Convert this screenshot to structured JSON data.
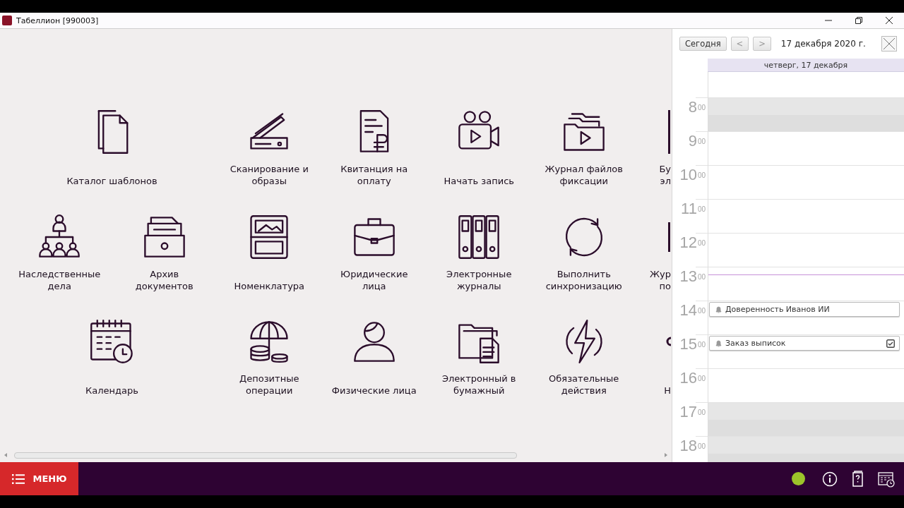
{
  "window": {
    "title": "Табеллион [990003]"
  },
  "tile_rows": [
    [
      {
        "label": "Каталог шаблонов",
        "kind": "full"
      },
      {
        "label": "Сканирование и\nобразы",
        "kind": "full"
      },
      {
        "label": "Квитанция на\nоплату",
        "kind": "full"
      },
      {
        "label": "Начать запись",
        "kind": "full"
      },
      {
        "label": "Журнал файлов\nфиксации",
        "kind": "full"
      },
      {
        "label": "Бу\nэл",
        "kind": "cut"
      }
    ],
    [
      {
        "label": "Наследственные\nдела",
        "kind": "full"
      },
      {
        "label": "Архив\nдокументов",
        "kind": "full"
      },
      {
        "label": "Номенклатура",
        "kind": "full"
      },
      {
        "label": "Юридические\nлица",
        "kind": "full"
      },
      {
        "label": "Электронные\nжурналы",
        "kind": "full"
      },
      {
        "label": "Выполнить\nсинхронизацию",
        "kind": "full"
      },
      {
        "label": "Жур\nпо",
        "kind": "cut"
      }
    ],
    [
      {
        "label": "Календарь",
        "kind": "full"
      },
      {
        "label": "Депозитные\nоперации",
        "kind": "full"
      },
      {
        "label": "Физические лица",
        "kind": "full"
      },
      {
        "label": "Электронный в\nбумажный",
        "kind": "full"
      },
      {
        "label": "Обязательные\nдействия",
        "kind": "full"
      },
      {
        "label": "Н",
        "kind": "cut"
      }
    ]
  ],
  "calendar": {
    "today_button": "Сегодня",
    "prev_button": "<",
    "next_button": ">",
    "date": "17 декабря 2020 г.",
    "day_header": "четверг, 17 декабря",
    "hours": [
      {
        "hour": "8",
        "minutes": "00",
        "shaded": true,
        "now": false
      },
      {
        "hour": "9",
        "minutes": "00",
        "shaded": false,
        "now": false
      },
      {
        "hour": "10",
        "minutes": "00",
        "shaded": false,
        "now": false
      },
      {
        "hour": "11",
        "minutes": "00",
        "shaded": false,
        "now": false
      },
      {
        "hour": "12",
        "minutes": "00",
        "shaded": false,
        "now": false
      },
      {
        "hour": "13",
        "minutes": "00",
        "shaded": false,
        "now": true
      },
      {
        "hour": "14",
        "minutes": "00",
        "shaded": false,
        "now": false,
        "events": [
          {
            "title": "Доверенность Иванов ИИ",
            "kind": "reminder"
          }
        ]
      },
      {
        "hour": "15",
        "minutes": "00",
        "shaded": false,
        "now": false,
        "events": [
          {
            "title": "Заказ выписок",
            "kind": "task",
            "checked": true
          }
        ]
      },
      {
        "hour": "16",
        "minutes": "00",
        "shaded": false,
        "now": false
      },
      {
        "hour": "17",
        "minutes": "00",
        "shaded": true,
        "now": false
      },
      {
        "hour": "18",
        "minutes": "00",
        "shaded": true,
        "now": false
      }
    ]
  },
  "bottom_bar": {
    "menu_label": "МЕНЮ"
  }
}
